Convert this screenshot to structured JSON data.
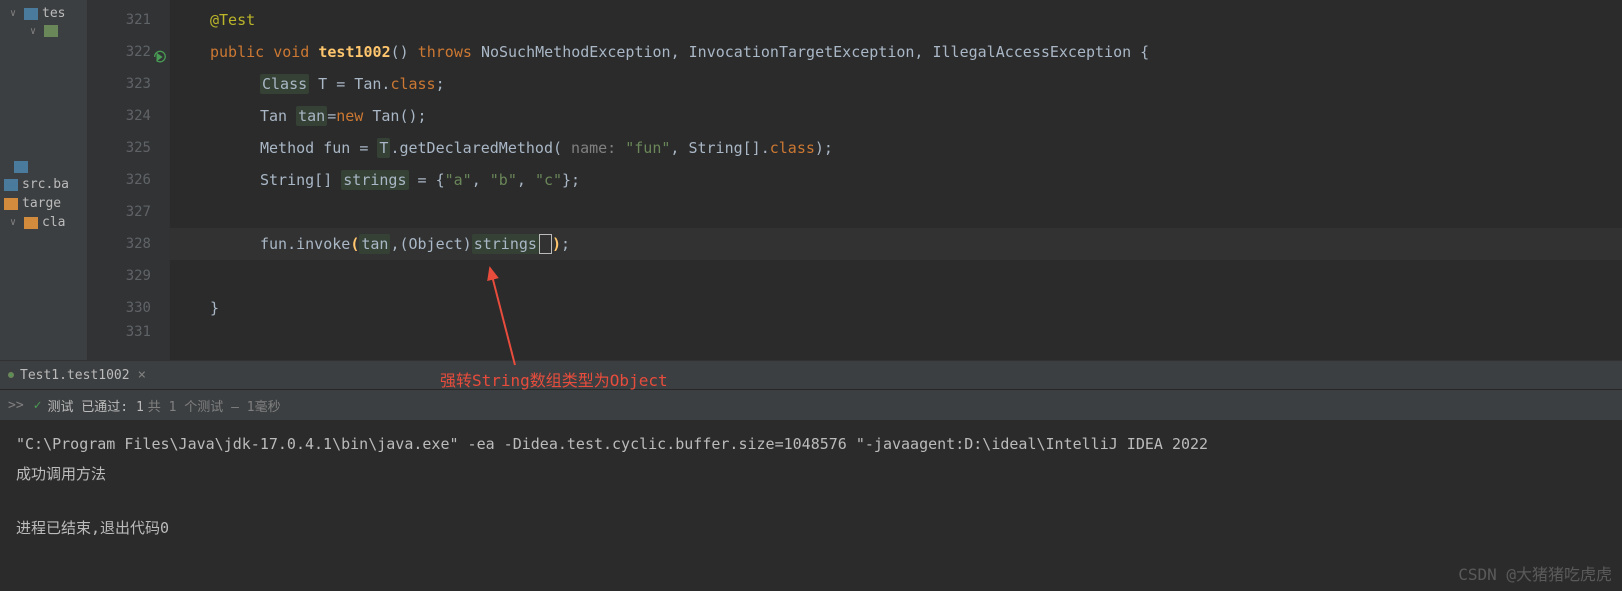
{
  "tree": {
    "items": [
      {
        "label": "tes",
        "folder": "folder-blue",
        "indent": 10,
        "chev": "∨"
      },
      {
        "label": "",
        "folder": "folder-green",
        "indent": 30,
        "chev": "∨"
      },
      {
        "label": "",
        "folder": "",
        "indent": 0,
        "chev": ""
      },
      {
        "label": "",
        "folder": "",
        "indent": 0,
        "chev": ""
      },
      {
        "label": "",
        "folder": "",
        "indent": 0,
        "chev": ""
      },
      {
        "label": "",
        "folder": "",
        "indent": 0,
        "chev": ""
      },
      {
        "label": "",
        "folder": "folder-blue",
        "indent": 0,
        "chev": ""
      },
      {
        "label": "src.ba",
        "folder": "folder-blue",
        "indent": 0,
        "chev": ""
      },
      {
        "label": "targe",
        "folder": "folder-orange",
        "indent": 0,
        "chev": ""
      },
      {
        "label": "cla",
        "folder": "folder-orange",
        "indent": 10,
        "chev": "∨"
      }
    ]
  },
  "gutter": {
    "start": 321,
    "end": 331
  },
  "code": {
    "l321": {
      "anno": "@Test"
    },
    "l322": {
      "kw1": "public",
      "kw2": "void",
      "fn": "test1002",
      "parens": "()",
      "kw3": "throws",
      "ex": "NoSuchMethodException, InvocationTargetException, IllegalAccessException {"
    },
    "l323": {
      "hl": "Class",
      "rest": " T = Tan.",
      "kw": "class",
      "semi": ";"
    },
    "l324": {
      "txt1": "Tan ",
      "hl": "tan",
      "txt2": "=",
      "kw": "new",
      "txt3": " Tan();"
    },
    "l325": {
      "txt1": "Method fun = ",
      "hl": "T",
      "txt2": ".getDeclaredMethod(",
      "param": " name: ",
      "str": "\"fun\"",
      "txt3": ", String[].",
      "kw": "class",
      "txt4": ");"
    },
    "l326": {
      "txt1": "String[] ",
      "hl": "strings",
      "txt2": " = {",
      "s1": "\"a\"",
      "c1": ", ",
      "s2": "\"b\"",
      "c2": ", ",
      "s3": "\"c\"",
      "txt3": "};"
    },
    "l328": {
      "txt1": "fun.invoke",
      "p1": "(",
      "hl1": "tan",
      "txt2": ",(Object)",
      "hl2": "strings",
      "cursor": " ",
      "p2": ")",
      "semi": ";"
    },
    "l330": {
      "brace": "}"
    }
  },
  "annotation": {
    "text": "强转String数组类型为Object"
  },
  "tab": {
    "label": "Test1.test1002",
    "close": "×"
  },
  "status": {
    "chevrons": ">>",
    "check": "✓",
    "text": "测试 已通过: 1",
    "suffix": "共 1 个测试 – 1毫秒"
  },
  "console": {
    "line1": "\"C:\\Program Files\\Java\\jdk-17.0.4.1\\bin\\java.exe\" -ea -Didea.test.cyclic.buffer.size=1048576 \"-javaagent:D:\\ideal\\IntelliJ IDEA 2022",
    "line2": "成功调用方法",
    "line3": "进程已结束,退出代码0"
  },
  "watermark": "CSDN @大猪猪吃虎虎"
}
